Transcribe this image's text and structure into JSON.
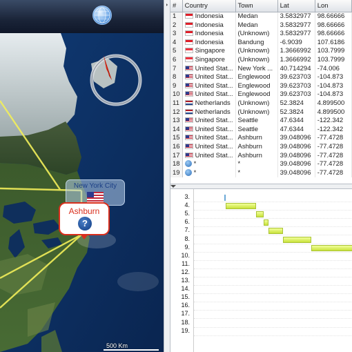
{
  "map": {
    "place_label": "New York City",
    "callout_label": "Ashburn",
    "callout_icon": "?",
    "scale_text": "500 Km",
    "route_color": "#f2ee5a",
    "callout_color": "#d92e1c",
    "compass": {
      "needle_color": "#d92e1c"
    }
  },
  "table": {
    "columns": [
      "#",
      "Country",
      "Town",
      "Lat",
      "Lon"
    ],
    "rows": [
      {
        "n": "1",
        "flag": "indonesia",
        "country": "Indonesia",
        "town": "Medan",
        "lat": "3.5832977",
        "lon": "98.66666"
      },
      {
        "n": "2",
        "flag": "indonesia",
        "country": "Indonesia",
        "town": "Medan",
        "lat": "3.5832977",
        "lon": "98.66666"
      },
      {
        "n": "3",
        "flag": "indonesia",
        "country": "Indonesia",
        "town": "(Unknown)",
        "lat": "3.5832977",
        "lon": "98.66666"
      },
      {
        "n": "4",
        "flag": "indonesia",
        "country": "Indonesia",
        "town": "Bandung",
        "lat": "-6.9039",
        "lon": "107.6186"
      },
      {
        "n": "5",
        "flag": "singapore",
        "country": "Singapore",
        "town": "(Unknown)",
        "lat": "1.3666992",
        "lon": "103.7999"
      },
      {
        "n": "6",
        "flag": "singapore",
        "country": "Singapore",
        "town": "(Unknown)",
        "lat": "1.3666992",
        "lon": "103.7999"
      },
      {
        "n": "7",
        "flag": "usa",
        "country": "United Stat...",
        "town": "New York ...",
        "lat": "40.714294",
        "lon": "-74.006"
      },
      {
        "n": "8",
        "flag": "usa",
        "country": "United Stat...",
        "town": "Englewood",
        "lat": "39.623703",
        "lon": "-104.873"
      },
      {
        "n": "9",
        "flag": "usa",
        "country": "United Stat...",
        "town": "Englewood",
        "lat": "39.623703",
        "lon": "-104.873"
      },
      {
        "n": "10",
        "flag": "usa",
        "country": "United Stat...",
        "town": "Englewood",
        "lat": "39.623703",
        "lon": "-104.873"
      },
      {
        "n": "11",
        "flag": "netherlands",
        "country": "Netherlands",
        "town": "(Unknown)",
        "lat": "52.3824",
        "lon": "4.899500"
      },
      {
        "n": "12",
        "flag": "netherlands",
        "country": "Netherlands",
        "town": "(Unknown)",
        "lat": "52.3824",
        "lon": "4.899500"
      },
      {
        "n": "13",
        "flag": "usa",
        "country": "United Stat...",
        "town": "Seattle",
        "lat": "47.6344",
        "lon": "-122.342"
      },
      {
        "n": "14",
        "flag": "usa",
        "country": "United Stat...",
        "town": "Seattle",
        "lat": "47.6344",
        "lon": "-122.342"
      },
      {
        "n": "15",
        "flag": "usa",
        "country": "United Stat...",
        "town": "Ashburn",
        "lat": "39.048096",
        "lon": "-77.4728"
      },
      {
        "n": "16",
        "flag": "usa",
        "country": "United Stat...",
        "town": "Ashburn",
        "lat": "39.048096",
        "lon": "-77.4728"
      },
      {
        "n": "17",
        "flag": "usa",
        "country": "United Stat...",
        "town": "Ashburn",
        "lat": "39.048096",
        "lon": "-77.4728"
      },
      {
        "n": "18",
        "flag": "unknown",
        "country": "*",
        "town": "*",
        "lat": "39.048096",
        "lon": "-77.4728"
      },
      {
        "n": "19",
        "flag": "unknown",
        "country": "*",
        "town": "*",
        "lat": "39.048096",
        "lon": "-77.4728"
      }
    ]
  },
  "gantt": {
    "rows": [
      "3.",
      "4.",
      "5.",
      "6.",
      "7.",
      "8.",
      "9.",
      "10.",
      "11.",
      "12.",
      "13.",
      "14.",
      "15.",
      "16.",
      "17.",
      "18.",
      "19."
    ],
    "bars": [
      {
        "row": 0,
        "start": 0.19,
        "end": 0.2,
        "style": "blue"
      },
      {
        "row": 1,
        "start": 0.2,
        "end": 0.39,
        "style": "yellow"
      },
      {
        "row": 2,
        "start": 0.39,
        "end": 0.44,
        "style": "yellow"
      },
      {
        "row": 3,
        "start": 0.44,
        "end": 0.47,
        "style": "yellow"
      },
      {
        "row": 4,
        "start": 0.47,
        "end": 0.56,
        "style": "yellow"
      },
      {
        "row": 5,
        "start": 0.56,
        "end": 0.74,
        "style": "yellow"
      },
      {
        "row": 6,
        "start": 0.74,
        "end": 1.0,
        "style": "yellow"
      }
    ]
  }
}
